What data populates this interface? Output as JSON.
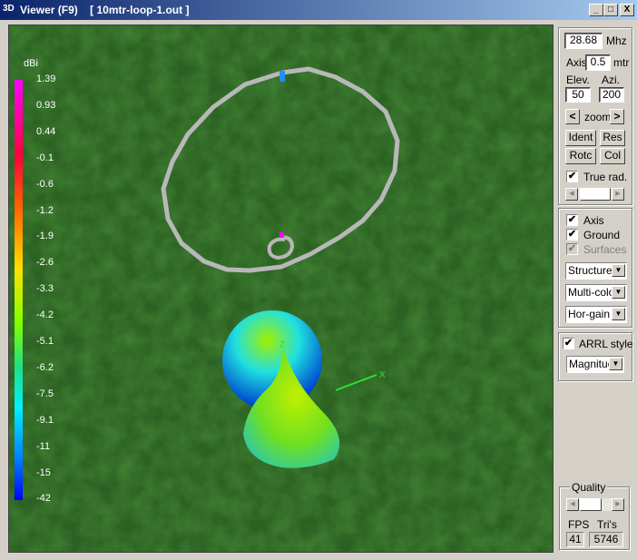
{
  "window": {
    "title": "Viewer (F9)    [ 10mtr-loop-1.out ]",
    "icon": "3D",
    "minimize": "_",
    "maximize": "□",
    "close": "X"
  },
  "legend": {
    "unit": "dBi",
    "values": [
      "1.39",
      "0.93",
      "0.44",
      "-0.1",
      "-0.6",
      "-1.2",
      "-1.9",
      "-2.6",
      "-3.3",
      "-4.2",
      "-5.1",
      "-6.2",
      "-7.5",
      "-9.1",
      "-11",
      "-15",
      "-42"
    ]
  },
  "scene": {
    "axis_label_z": "Z",
    "axis_label_x": "X"
  },
  "panel": {
    "frequency": "28.68",
    "freq_unit": "Mhz",
    "axis_label": "Axis",
    "axis_value": "0.5",
    "axis_unit": "mtr",
    "elev_label": "Elev.",
    "azi_label": "Azi.",
    "elev_value": "50",
    "azi_value": "200",
    "zoom_prev": "<",
    "zoom_label": "zoom",
    "zoom_next": ">",
    "ident": "Ident",
    "res": "Res",
    "rotc": "Rotc",
    "col": "Col",
    "true_rad": "True rad.",
    "true_rad_checked": true,
    "axis_check": "Axis",
    "ground_check": "Ground",
    "surfaces_check": "Surfaces",
    "structure_select": "Structure",
    "color_select": "Multi-colo",
    "gain_select": "Hor-gain",
    "arrl_style": "ARRL style",
    "magnitude_select": "Magnitude",
    "quality_label": "Quality",
    "fps_label": "FPS",
    "tris_label": "Tri's",
    "fps": "41",
    "tris": "5746"
  }
}
